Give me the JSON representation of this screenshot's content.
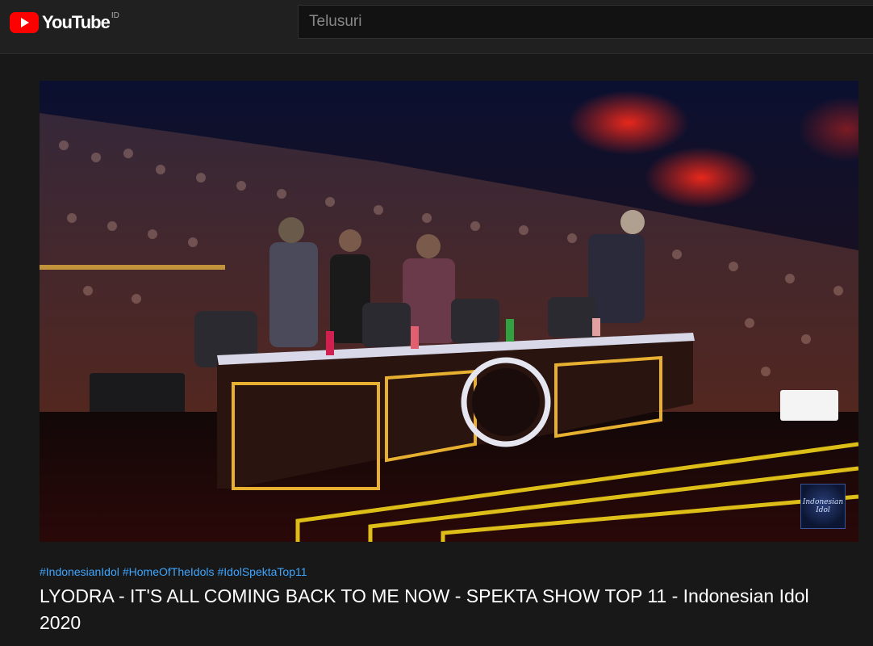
{
  "masthead": {
    "logo_text": "YouTube",
    "country_code": "ID",
    "search_placeholder": "Telusuri"
  },
  "player": {
    "watermark_text": "Indonesian Idol"
  },
  "video": {
    "hashtags": [
      "#IndonesianIdol",
      "#HomeOfTheIdols",
      "#IdolSpektaTop11"
    ],
    "title": "LYODRA - IT'S ALL COMING BACK TO ME NOW - SPEKTA SHOW TOP 11 - Indonesian Idol 2020"
  },
  "colors": {
    "background": "#181818",
    "masthead": "#202020",
    "hashtag": "#3ea6ff",
    "logo_red": "#ff0000"
  },
  "icons": [
    "youtube-logo-icon"
  ]
}
